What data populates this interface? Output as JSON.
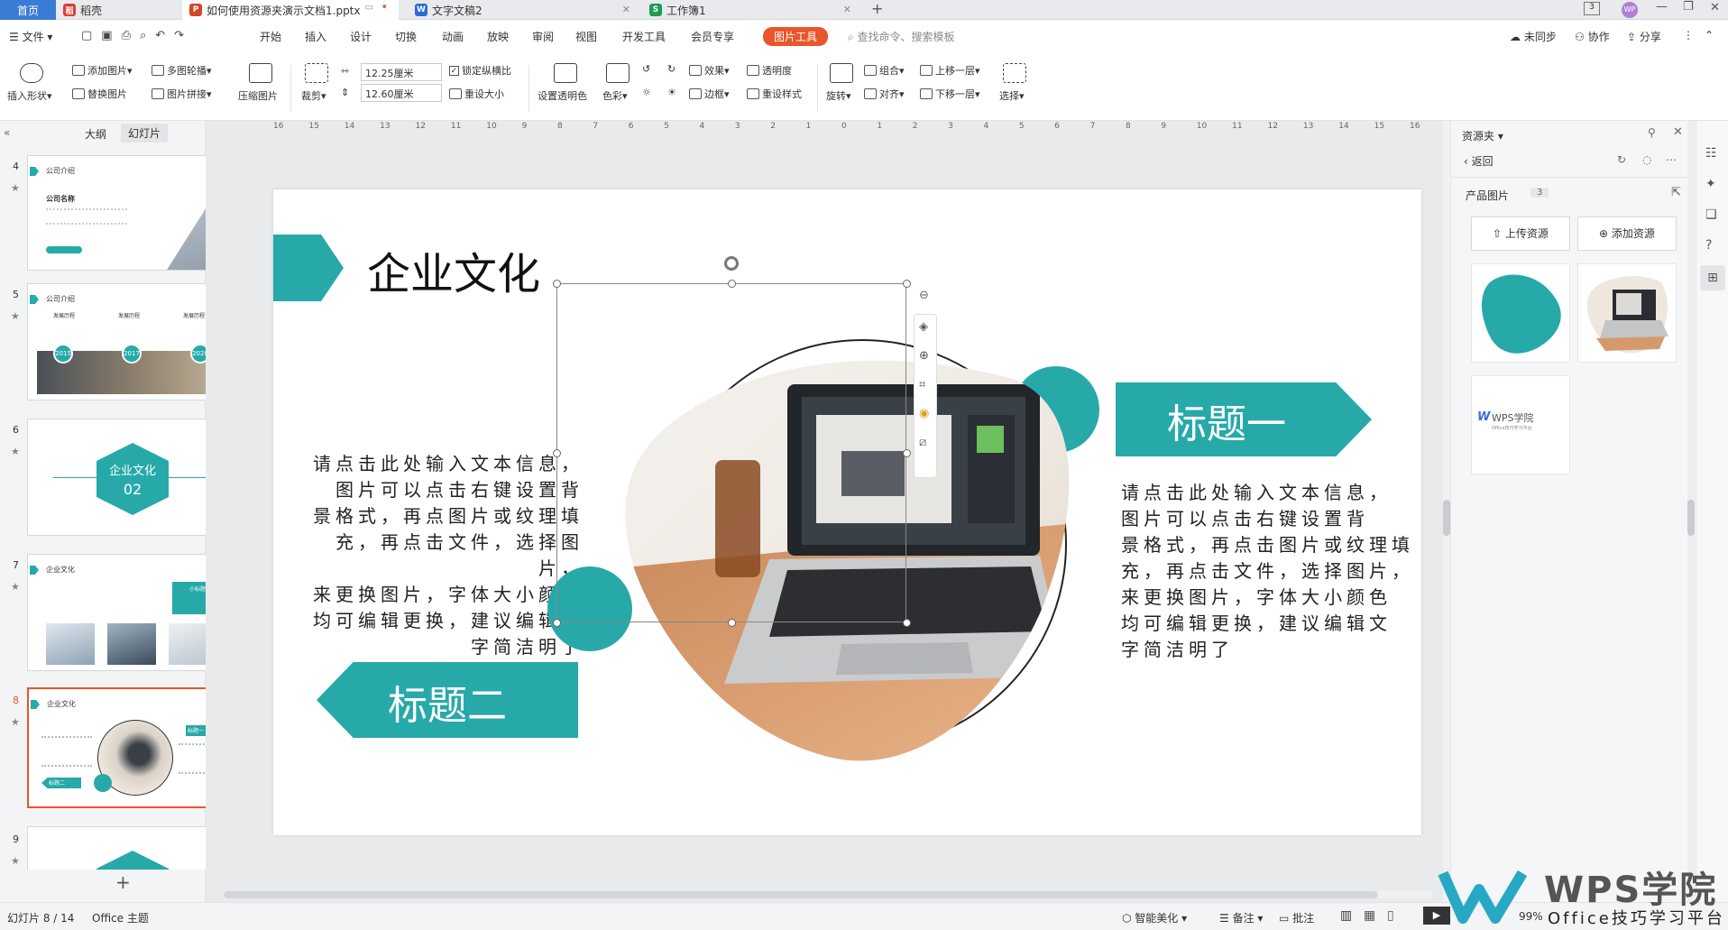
{
  "tabs": {
    "home": "首页",
    "daoke": "稻壳",
    "ppt": "如何使用资源夹演示文档1.pptx",
    "doc": "文字文稿2",
    "sheet": "工作簿1"
  },
  "menu": {
    "file": "文件",
    "items": [
      "开始",
      "插入",
      "设计",
      "切换",
      "动画",
      "放映",
      "审阅",
      "视图",
      "开发工具",
      "会员专享"
    ],
    "pic_tools": "图片工具",
    "search": "查找命令、搜索模板",
    "unsync": "未同步",
    "collab": "协作",
    "share": "分享"
  },
  "ribbon": {
    "insert_shape": "插入形状",
    "add_pic": "添加图片",
    "multi_carousel": "多图轮播",
    "replace_pic": "替换图片",
    "pic_collage": "图片拼接",
    "compress": "压缩图片",
    "crop": "裁剪",
    "width": "12.25厘米",
    "height": "12.60厘米",
    "lock_ratio": "锁定纵横比",
    "reset_size": "重设大小",
    "set_transparent": "设置透明色",
    "color": "色彩",
    "effect": "效果",
    "transparency": "透明度",
    "border": "边框",
    "reset_style": "重设样式",
    "rotate": "旋转",
    "group": "组合",
    "align": "对齐",
    "bring_up": "上移一层",
    "send_down": "下移一层",
    "select": "选择"
  },
  "leftpanel": {
    "tab_outline": "大纲",
    "tab_slides": "幻灯片",
    "thumbs": [
      {
        "num": "4",
        "title": "公司介绍",
        "sub": "公司名称"
      },
      {
        "num": "5",
        "title": "公司介绍",
        "years": [
          "2015",
          "2017",
          "2020"
        ],
        "labels": [
          "发展历程",
          "发展历程",
          "发展历程"
        ]
      },
      {
        "num": "6",
        "line1": "企业文化",
        "line2": "02"
      },
      {
        "num": "7",
        "title": "企业文化",
        "tag": "小标题"
      },
      {
        "num": "8",
        "title": "企业文化",
        "t1": "标题一",
        "t2": "标题二"
      },
      {
        "num": "9"
      }
    ],
    "add": "+"
  },
  "ruler": [
    "16",
    "15",
    "14",
    "13",
    "12",
    "11",
    "10",
    "9",
    "8",
    "7",
    "6",
    "5",
    "4",
    "3",
    "2",
    "1",
    "0",
    "1",
    "2",
    "3",
    "4",
    "5",
    "6",
    "7",
    "8",
    "9",
    "10",
    "11",
    "12",
    "13",
    "14",
    "15",
    "16"
  ],
  "slide": {
    "title": "企业文化",
    "heading1": "标题一",
    "heading2": "标题二",
    "body_left": [
      "请点击此处输入文本信息，",
      "图片可以点击右键设置背",
      "景格式，再点图片或纹理填",
      "充，再点击文件，选择图片，",
      "来更换图片，字体大小颜色",
      "均可编辑更换，建议编辑文",
      "字简洁明了"
    ],
    "body_right": [
      "请点击此处输入文本信息，",
      "图片可以点击右键设置背",
      "景格式，再点击图片或纹理填",
      "充，再点击文件，选择图片，",
      "来更换图片，字体大小颜色",
      "均可编辑更换，建议编辑文",
      "字简洁明了"
    ]
  },
  "rightpanel": {
    "title": "资源夹",
    "back": "返回",
    "category": "产品图片",
    "count": "3",
    "upload": "上传资源",
    "add": "添加资源",
    "wps_logo": "WPS学院",
    "wps_sub": "Office技巧学习平台"
  },
  "status": {
    "slide_pos": "幻灯片 8 / 14",
    "theme": "Office 主题",
    "beautify": "智能美化",
    "notes": "备注",
    "comments": "批注",
    "zoom": "99%"
  },
  "watermark": {
    "title": "WPS学院",
    "sub": "Office技巧学习平台"
  },
  "colors": {
    "teal": "#27a9a9",
    "accent": "#e8562a",
    "home_tab": "#3a7bd5"
  }
}
